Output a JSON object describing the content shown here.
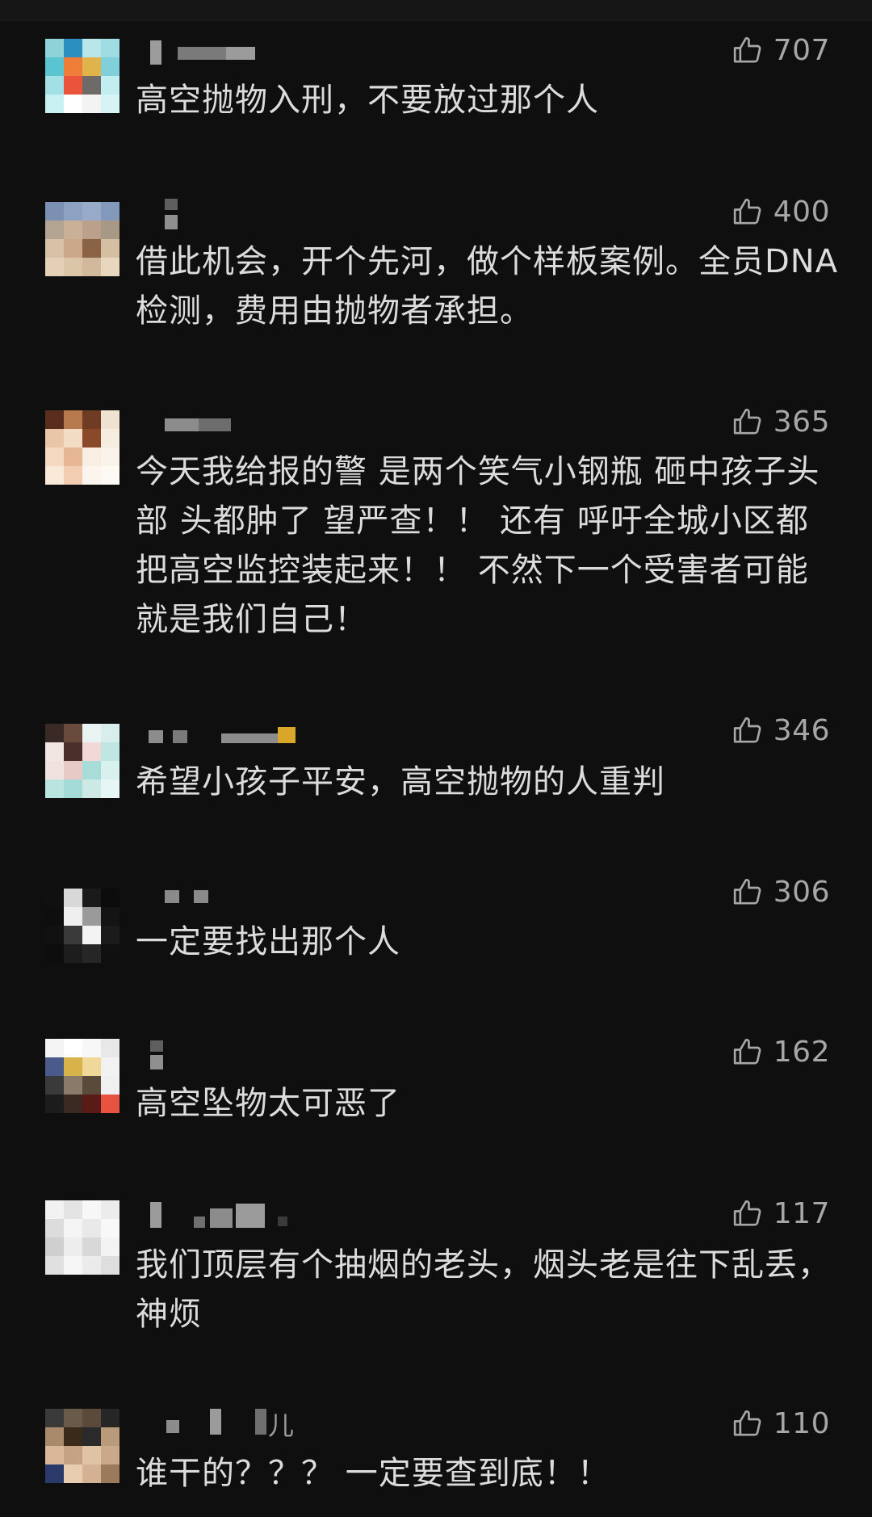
{
  "comments": [
    {
      "name": "",
      "likes": "707",
      "text": "高空抛物入刑，不要放过那个人"
    },
    {
      "name": "",
      "likes": "400",
      "text": "借此机会，开个先河，做个样板案例。全员DNA检测，费用由抛物者承担。"
    },
    {
      "name": "",
      "likes": "365",
      "text": "今天我给报的警 是两个笑气小钢瓶 砸中孩子头部 头都肿了 望严查！！ 还有 呼吁全城小区都把高空监控装起来！！ 不然下一个受害者可能就是我们自己！"
    },
    {
      "name": "",
      "likes": "346",
      "text": "希望小孩子平安，高空抛物的人重判"
    },
    {
      "name": "",
      "likes": "306",
      "text": "一定要找出那个人"
    },
    {
      "name": "",
      "likes": "162",
      "text": "高空坠物太可恶了"
    },
    {
      "name": "",
      "likes": "117",
      "text": "我们顶层有个抽烟的老头，烟头老是往下乱丢，神烦"
    },
    {
      "name": "儿",
      "likes": "110",
      "text": "谁干的？？？ 一定要查到底！！"
    }
  ],
  "icons": {
    "like": "thumbs-up-icon"
  },
  "colors": {
    "background": "#0f0f10",
    "text": "#dcdcdc",
    "muted": "#a7a7a7"
  }
}
